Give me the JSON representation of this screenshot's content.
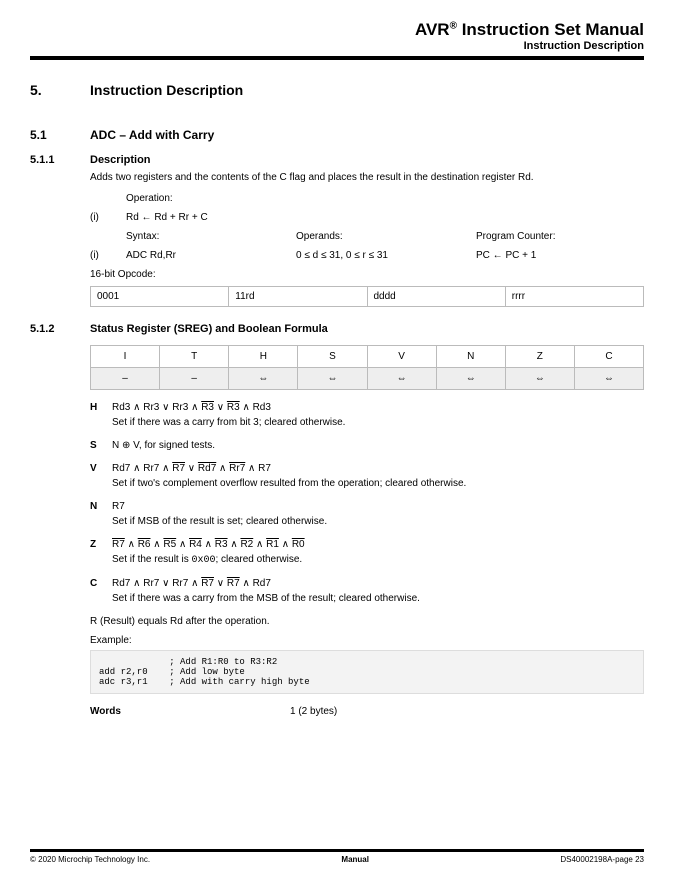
{
  "header": {
    "title_prefix": "AVR",
    "title_suffix": " Instruction Set Manual",
    "subtitle": "Instruction Description"
  },
  "sec5": {
    "num": "5.",
    "title": "Instruction Description"
  },
  "sec51": {
    "num": "5.1",
    "title": "ADC – Add with Carry"
  },
  "sec511": {
    "num": "5.1.1",
    "title": "Description",
    "text": "Adds two registers and the contents of the C flag and places the result in the destination register Rd.",
    "operation_label": "Operation:",
    "op_i": "(i)",
    "op_text": "Rd ← Rd + Rr + C",
    "syntax_h": "Syntax:",
    "operands_h": "Operands:",
    "pc_h": "Program Counter:",
    "syntax_i": "(i)",
    "syntax_v": "ADC Rd,Rr",
    "operands_v": "0 ≤ d ≤ 31, 0 ≤ r ≤ 31",
    "pc_v": "PC ← PC + 1",
    "opcode_label": "16-bit Opcode:",
    "opcode": [
      "0001",
      "11rd",
      "dddd",
      "rrrr"
    ]
  },
  "sec512": {
    "num": "5.1.2",
    "title": "Status Register (SREG) and Boolean Formula",
    "sreg_headers": [
      "I",
      "T",
      "H",
      "S",
      "V",
      "N",
      "Z",
      "C"
    ],
    "sreg_values": [
      "–",
      "–",
      "⇔",
      "⇔",
      "⇔",
      "⇔",
      "⇔",
      "⇔"
    ],
    "flags": {
      "H": {
        "desc": "Set if there was a carry from bit 3; cleared otherwise."
      },
      "S": {
        "formula": "N ⊕ V, for signed tests."
      },
      "V": {
        "desc": "Set if two's complement overflow resulted from the operation; cleared otherwise."
      },
      "N": {
        "formula": "R7",
        "desc": "Set if MSB of the result is set; cleared otherwise."
      },
      "Z": {
        "desc_a": "Set if the result is ",
        "desc_code": "0x00",
        "desc_b": "; cleared otherwise."
      },
      "C": {
        "desc": "Set if there was a carry from the MSB of the result; cleared otherwise."
      }
    },
    "result": "R (Result) equals Rd after the operation.",
    "example_label": "Example:",
    "code": "             ; Add R1:R0 to R3:R2\nadd r2,r0    ; Add low byte\nadc r3,r1    ; Add with carry high byte",
    "words_label": "Words",
    "words_value": "1 (2 bytes)"
  },
  "footer": {
    "left": "© 2020 Microchip Technology Inc.",
    "center": "Manual",
    "right": "DS40002198A-page 23"
  }
}
